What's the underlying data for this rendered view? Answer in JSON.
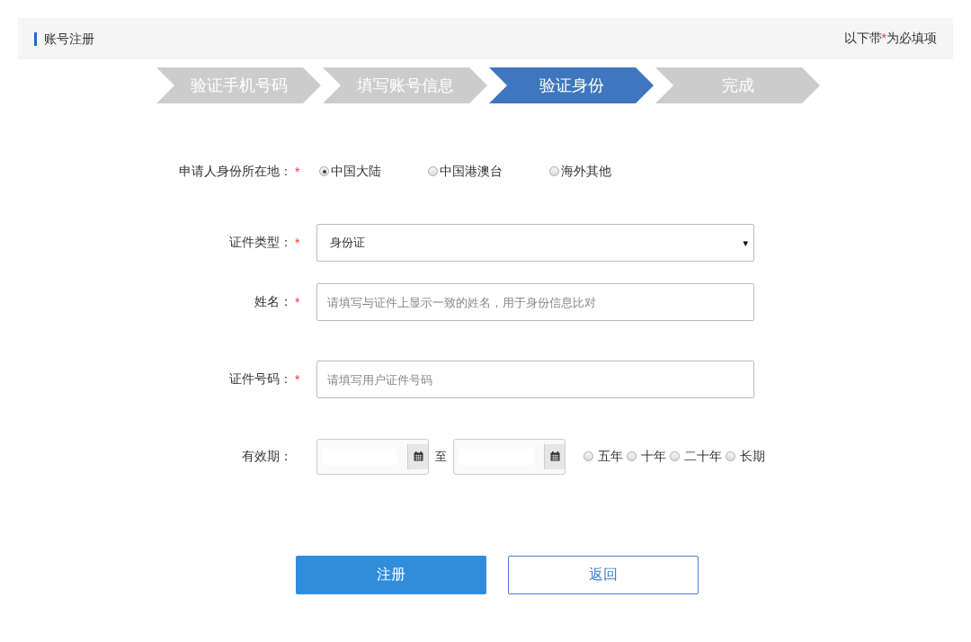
{
  "header": {
    "title": "账号注册",
    "required_note": {
      "before": "以下带",
      "mark": "*",
      "after": "为必填项"
    }
  },
  "steps": [
    {
      "label": "验证手机号码",
      "selected": false
    },
    {
      "label": "填写账号信息",
      "selected": false
    },
    {
      "label": "验证身份",
      "selected": true
    },
    {
      "label": "完成",
      "selected": false
    }
  ],
  "fields": [
    {
      "kind": "radio",
      "label": "申请人身份所在地：",
      "required_mark": "*",
      "options": [
        {
          "label": "中国大陆",
          "selected": true
        },
        {
          "label": "中国港澳台",
          "selected": false
        },
        {
          "label": "海外其他",
          "selected": false
        }
      ]
    },
    {
      "kind": "select",
      "label": "证件类型：",
      "required_mark": "*",
      "value": "身份证",
      "caret": "▾"
    },
    {
      "kind": "text",
      "label": "姓名：",
      "required_mark": "*",
      "placeholder": "请填写与证件上显示一致的姓名，用于身份信息比对"
    },
    {
      "kind": "text",
      "label": "证件号码：",
      "required_mark": "*",
      "placeholder": "请填写用户证件号码"
    },
    {
      "kind": "daterange",
      "label": "有效期：",
      "separator": "至",
      "options": [
        {
          "label": "五年",
          "selected": false
        },
        {
          "label": "十年",
          "selected": false
        },
        {
          "label": "二十年",
          "selected": false
        },
        {
          "label": "长期",
          "selected": false
        }
      ]
    }
  ],
  "buttons": [
    {
      "label": "注册",
      "kind": "primary"
    },
    {
      "label": "返回",
      "kind": "secondary"
    }
  ]
}
